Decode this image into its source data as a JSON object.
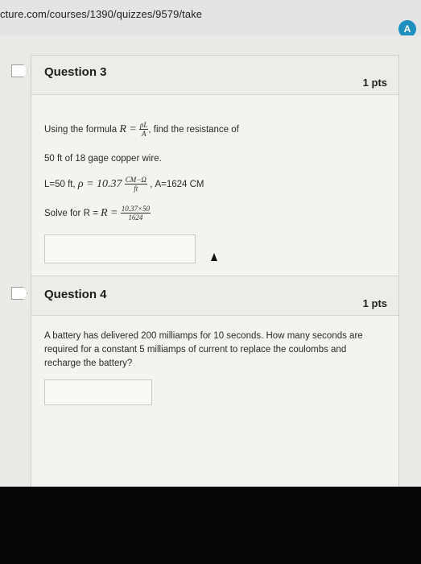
{
  "browser": {
    "url": "cture.com/courses/1390/quizzes/9579/take",
    "extension_icon_label": "A"
  },
  "q3": {
    "title": "Question 3",
    "points": "1 pts",
    "line1_a": "Using the formula",
    "formula_lhs": "R =",
    "formula_num": "ρL",
    "formula_den": "A",
    "line1_b": ", find the resistance of",
    "line2": "50 ft of 18 gage copper wire.",
    "given_a": "L=50 ft,",
    "rho_lhs": "ρ = 10.37",
    "rho_num": "CM−Ω",
    "rho_den": "ft",
    "given_b": ", A=1624 CM",
    "solve_a": "Solve for R = ",
    "solve_lhs": "R =",
    "solve_num": "10.37×50",
    "solve_den": "1624"
  },
  "q4": {
    "title": "Question 4",
    "points": "1 pts",
    "text": "A battery has delivered 200 milliamps for 10 seconds. How many seconds are required for a constant 5 milliamps of current to replace the coulombs and recharge the battery?"
  }
}
